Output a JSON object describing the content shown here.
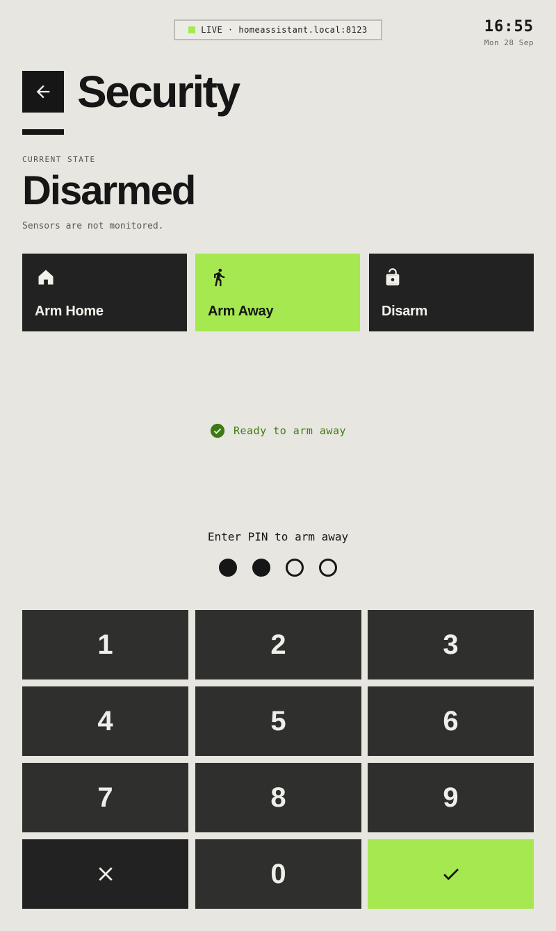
{
  "status_bar": {
    "live_label": "LIVE · homeassistant.local:8123",
    "live_color": "#a6e84f",
    "time": "16:55",
    "date": "Mon 28 Sep"
  },
  "header": {
    "back_icon": "arrow-left-icon",
    "title": "Security"
  },
  "alarm_state": {
    "label": "CURRENT STATE",
    "value": "Disarmed",
    "description": "Sensors are not monitored."
  },
  "modes": [
    {
      "label": "Arm Home",
      "icon": "home-icon",
      "active": false
    },
    {
      "label": "Arm Away",
      "icon": "walking-person-icon",
      "active": true
    },
    {
      "label": "Disarm",
      "icon": "unlock-icon",
      "active": false
    }
  ],
  "ready": {
    "icon": "check-circle-icon",
    "text": "Ready to arm away",
    "color": "#3d7a14"
  },
  "pin": {
    "prompt": "Enter PIN to arm away",
    "length": 4,
    "filled": 2
  },
  "keypad": {
    "keys": [
      "1",
      "2",
      "3",
      "4",
      "5",
      "6",
      "7",
      "8",
      "9"
    ],
    "zero": "0",
    "clear_icon": "close-icon",
    "confirm_icon": "checkmark-icon"
  },
  "colors": {
    "background": "#e8e6e0",
    "accent": "#a6e84f",
    "dark": "#161616"
  }
}
